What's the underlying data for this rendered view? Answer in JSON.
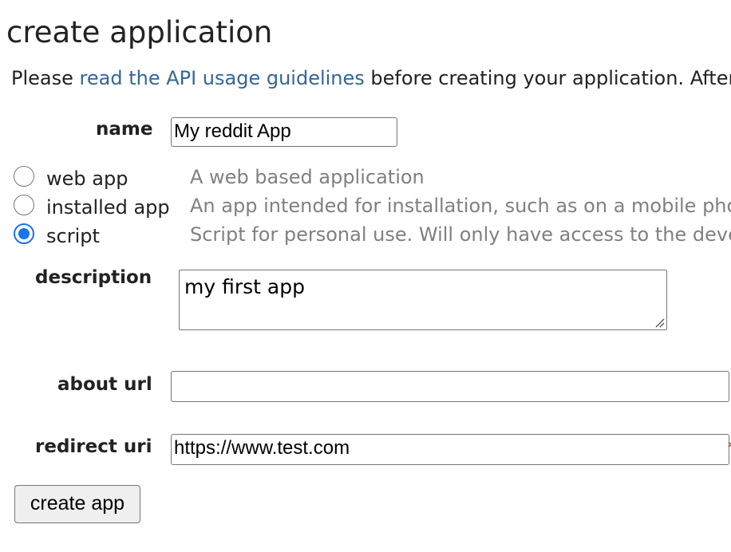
{
  "page": {
    "title": "create application",
    "intro": {
      "prefix": "Please ",
      "link_text": "read the API usage guidelines",
      "suffix": " before creating your application. After creating, you will be required to register for production API use."
    }
  },
  "form": {
    "name": {
      "label": "name",
      "value": "My reddit App"
    },
    "app_types": [
      {
        "label": "web app",
        "description": "A web based application",
        "checked": false
      },
      {
        "label": "installed app",
        "description": "An app intended for installation, such as on a mobile phone",
        "checked": false
      },
      {
        "label": "script",
        "description": "Script for personal use. Will only have access to the developer's accounts",
        "checked": true
      }
    ],
    "description": {
      "label": "description",
      "value": "my first app"
    },
    "about_url": {
      "label": "about url",
      "value": ""
    },
    "redirect_uri": {
      "label": "redirect uri",
      "value": "https://www.test.com",
      "required_mark": "*"
    },
    "submit_label": "create app"
  },
  "colors": {
    "link": "#336699",
    "radio_selected": "#1a73e8",
    "hint_text": "#808080"
  }
}
